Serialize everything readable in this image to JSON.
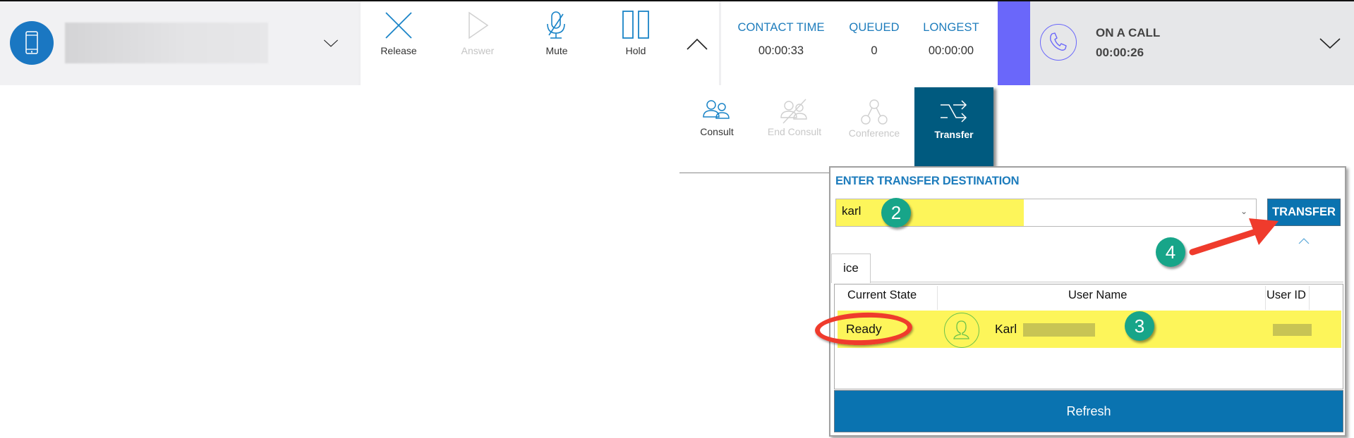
{
  "agent": {
    "name_redacted": true,
    "device_icon": "mobile-phone-icon"
  },
  "call_controls": [
    {
      "id": "release",
      "label": "Release",
      "icon": "close-x-icon",
      "enabled": true
    },
    {
      "id": "answer",
      "label": "Answer",
      "icon": "play-icon",
      "enabled": false
    },
    {
      "id": "mute",
      "label": "Mute",
      "icon": "microphone-muted-icon",
      "enabled": true
    },
    {
      "id": "hold",
      "label": "Hold",
      "icon": "pause-icon",
      "enabled": true
    }
  ],
  "stats": [
    {
      "label": "CONTACT TIME",
      "value": "00:00:33"
    },
    {
      "label": "QUEUED",
      "value": "0"
    },
    {
      "label": "LONGEST",
      "value": "00:00:00"
    }
  ],
  "status": {
    "title": "ON A CALL",
    "time": "00:00:26",
    "icon": "phone-icon",
    "accent_color": "#6a67fa"
  },
  "secondary_controls": [
    {
      "id": "consult",
      "label": "Consult",
      "icon": "users-icon",
      "enabled": true,
      "active": false
    },
    {
      "id": "end-consult",
      "label": "End Consult",
      "icon": "users-slash-icon",
      "enabled": false,
      "active": false
    },
    {
      "id": "conference",
      "label": "Conference",
      "icon": "conference-nodes-icon",
      "enabled": false,
      "active": false
    },
    {
      "id": "transfer",
      "label": "Transfer",
      "icon": "shuffle-arrows-icon",
      "enabled": true,
      "active": true
    }
  ],
  "transfer_panel": {
    "title": "ENTER TRANSFER DESTINATION",
    "destination_value": "karl",
    "transfer_button": "TRANSFER",
    "tab_label": "ice",
    "columns": [
      "Current State",
      "User Name",
      "User ID"
    ],
    "rows": [
      {
        "state": "Ready",
        "user_name": "Karl",
        "user_name_redacted": true,
        "user_id_redacted": true
      }
    ],
    "refresh_button": "Refresh"
  },
  "annotations": [
    {
      "number": "2",
      "target": "destination-input"
    },
    {
      "number": "3",
      "target": "result-row"
    },
    {
      "number": "4",
      "target": "transfer-button"
    }
  ],
  "colors": {
    "brand_blue": "#0a73b0",
    "active_tab": "#005a7f",
    "label_blue": "#1d7cbc",
    "highlight_yellow": "#fdf55a",
    "annotation_red": "#ef3b2c",
    "badge_green": "#17a589"
  }
}
